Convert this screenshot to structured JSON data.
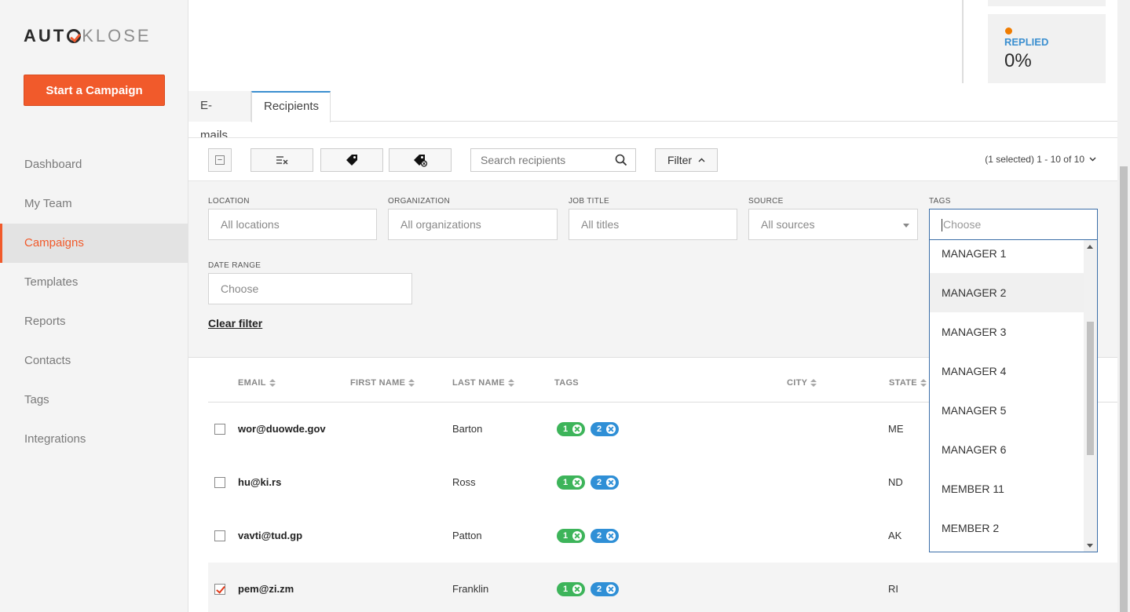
{
  "brand": {
    "logo_bold": "AUT",
    "logo_light": "KLOSE",
    "accent": "#f15a2b"
  },
  "sidebar": {
    "cta_label": "Start a Campaign",
    "items": [
      {
        "label": "Dashboard"
      },
      {
        "label": "My Team"
      },
      {
        "label": "Campaigns",
        "active": true
      },
      {
        "label": "Templates"
      },
      {
        "label": "Reports"
      },
      {
        "label": "Contacts"
      },
      {
        "label": "Tags"
      },
      {
        "label": "Integrations"
      }
    ]
  },
  "stats": {
    "replied_label": "REPLIED",
    "replied_value": "0%"
  },
  "tabs": [
    {
      "label": "E-mails"
    },
    {
      "label": "Recipients",
      "active": true
    }
  ],
  "toolbar": {
    "search_placeholder": "Search recipients",
    "filter_label": "Filter",
    "pager": "(1 selected) 1 - 10 of 10"
  },
  "filters": {
    "location": {
      "label": "LOCATION",
      "placeholder": "All locations"
    },
    "organization": {
      "label": "ORGANIZATION",
      "placeholder": "All organizations"
    },
    "job_title": {
      "label": "JOB TITLE",
      "placeholder": "All titles"
    },
    "source": {
      "label": "SOURCE",
      "value": "All sources"
    },
    "tags": {
      "label": "TAGS",
      "placeholder": "Choose"
    },
    "date_range": {
      "label": "DATE RANGE",
      "placeholder": "Choose"
    },
    "clear_label": "Clear filter"
  },
  "tag_options": [
    "MANAGER 1",
    "MANAGER 2",
    "MANAGER 3",
    "MANAGER 4",
    "MANAGER 5",
    "MANAGER 6",
    "MEMBER 11",
    "MEMBER 2"
  ],
  "table": {
    "headers": {
      "email": "EMAIL",
      "first_name": "FIRST NAME",
      "last_name": "LAST NAME",
      "tags": "TAGS",
      "city": "CITY",
      "state": "STATE"
    },
    "rows": [
      {
        "email": "wor@duowde.gov",
        "last_name": "Barton",
        "state": "ME",
        "tags": [
          "1",
          "2"
        ],
        "checked": false
      },
      {
        "email": "hu@ki.rs",
        "last_name": "Ross",
        "state": "ND",
        "tags": [
          "1",
          "2"
        ],
        "checked": false
      },
      {
        "email": "vavti@tud.gp",
        "last_name": "Patton",
        "state": "AK",
        "tags": [
          "1",
          "2"
        ],
        "checked": false
      },
      {
        "email": "pem@zi.zm",
        "last_name": "Franklin",
        "state": "RI",
        "tags": [
          "1",
          "2"
        ],
        "checked": true
      }
    ]
  }
}
